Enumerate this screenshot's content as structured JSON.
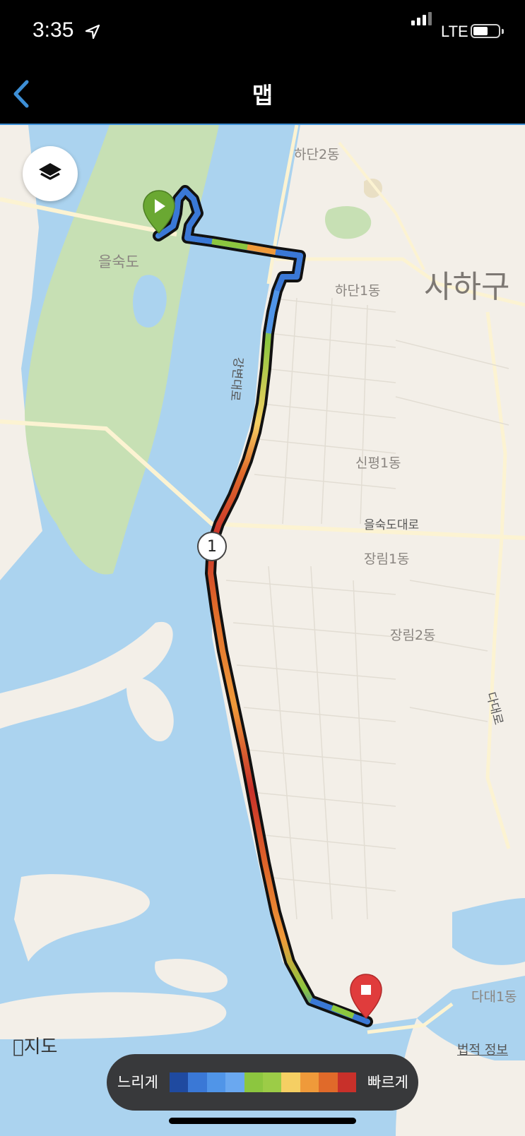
{
  "status_bar": {
    "time": "3:35",
    "network": "LTE",
    "battery_level": 0.5
  },
  "nav": {
    "title": "맵"
  },
  "map": {
    "labels": {
      "eulsukdo": "을숙도",
      "hadan2": "하단2동",
      "hadan1": "하단1동",
      "sahagu": "사하구",
      "sinpyeong1": "신평1동",
      "eulsukdo_road": "을숙도대로",
      "jangrim1": "장림1동",
      "jangrim2": "장림2동",
      "gangbyeon_road": "강변대로",
      "dadae_road": "다대로",
      "dadae1": "다대1동"
    },
    "lap_marker": "1",
    "apple_maps": "지도",
    "legal": "법적 정보"
  },
  "legend": {
    "slow": "느리게",
    "fast": "빠르게",
    "colors": [
      "#1f4aa0",
      "#3a78d6",
      "#5095e8",
      "#6aa8f0",
      "#8cc63f",
      "#9ccc47",
      "#f5cf63",
      "#ef9a3a",
      "#e06a2a",
      "#c8302a"
    ]
  },
  "icons": {
    "layers": "layers-icon",
    "back": "chevron-left-icon",
    "start": "start-marker-icon",
    "end": "finish-marker-icon",
    "location": "location-arrow-icon"
  }
}
